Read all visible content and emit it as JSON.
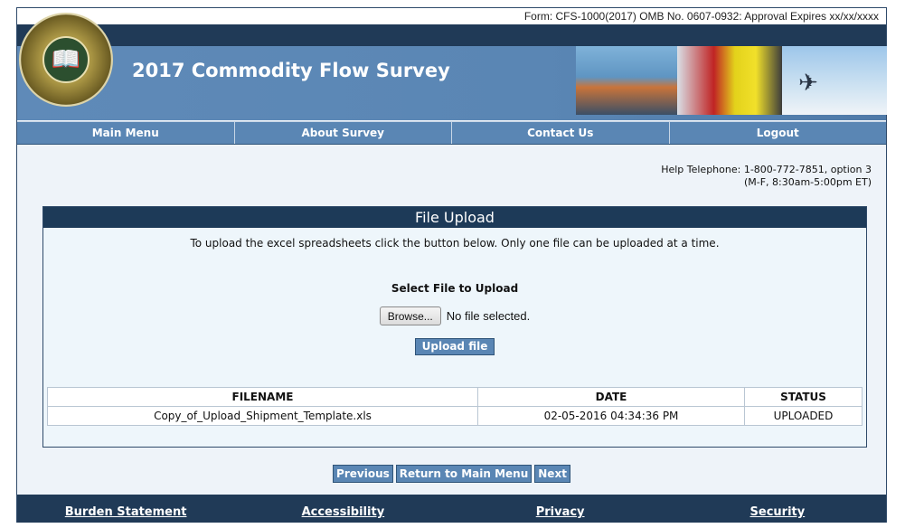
{
  "form_line": "Form: CFS-1000(2017) OMB No. 0607-0932: Approval Expires  xx/xx/xxxx",
  "site_title": "2017 Commodity Flow Survey",
  "nav": [
    {
      "label": "Main Menu"
    },
    {
      "label": "About Survey"
    },
    {
      "label": "Contact Us"
    },
    {
      "label": "Logout"
    }
  ],
  "help": {
    "telephone": "Help Telephone: 1-800-772-7851, option 3",
    "hours": "(M-F, 8:30am-5:00pm ET)"
  },
  "panel": {
    "title": "File Upload",
    "instructions": "To upload the excel spreadsheets click the button below. Only one file can be uploaded at a time.",
    "select_label": "Select File to Upload",
    "browse_label": "Browse...",
    "no_file": "No file selected.",
    "upload_label": "Upload file"
  },
  "table": {
    "headers": [
      "FILENAME",
      "DATE",
      "STATUS"
    ],
    "rows": [
      [
        "Copy_of_Upload_Shipment_Template.xls",
        "02-05-2016 04:34:36 PM",
        "UPLOADED"
      ]
    ]
  },
  "actions": {
    "previous": "Previous",
    "return": "Return to Main Menu",
    "next": "Next"
  },
  "footer": [
    {
      "label": "Burden Statement"
    },
    {
      "label": "Accessibility"
    },
    {
      "label": "Privacy"
    },
    {
      "label": "Security"
    }
  ],
  "colors": {
    "navy": "#203a57",
    "steel_blue": "#5a86b4",
    "panel_bg": "#eef6fb"
  }
}
